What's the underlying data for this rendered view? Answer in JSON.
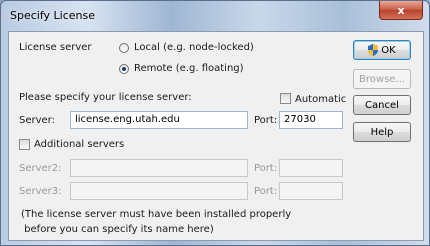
{
  "window": {
    "title": "Specify License",
    "close_glyph": "x"
  },
  "license_server": {
    "label": "License server",
    "options": [
      {
        "label": "Local (e.g. node-locked)",
        "selected": false
      },
      {
        "label": "Remote (e.g. floating)",
        "selected": true
      }
    ]
  },
  "prompt": "Please specify your license server:",
  "automatic": {
    "label": "Automatic",
    "checked": false
  },
  "server": {
    "label": "Server:",
    "value": "license.eng.utah.edu"
  },
  "port": {
    "label": "Port:",
    "value": "27030"
  },
  "additional": {
    "label": "Additional servers",
    "checked": false
  },
  "server2": {
    "label": "Server2:",
    "value": "",
    "port_label": "Port:",
    "port_value": ""
  },
  "server3": {
    "label": "Server3:",
    "value": "",
    "port_label": "Port:",
    "port_value": ""
  },
  "note": {
    "line1": "(The license server must have been installed properly",
    "line2": " before you can specify its name here)"
  },
  "buttons": {
    "ok": "OK",
    "browse": "Browse...",
    "cancel": "Cancel",
    "help": "Help"
  },
  "colors": {
    "accent": "#1c3d76",
    "close": "#c75a43"
  },
  "icons": {
    "ok": "uac-shield-icon"
  }
}
